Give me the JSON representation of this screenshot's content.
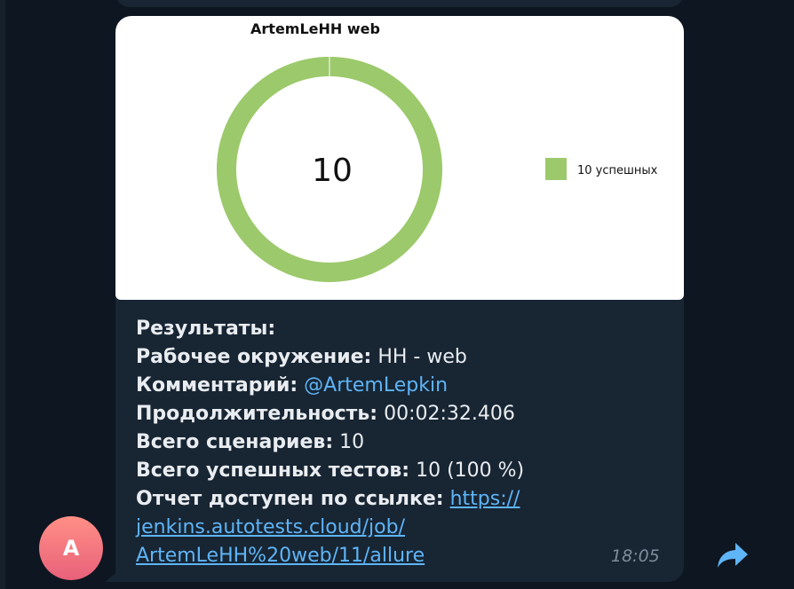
{
  "colors": {
    "background": "#0e1621",
    "bubble": "#182533",
    "link": "#5eb5f7",
    "success": "#9cc96b"
  },
  "chart_data": {
    "type": "pie",
    "title": "ArtemLeHH web",
    "center_label": "10",
    "slices": [
      {
        "label": "10 успешных",
        "value": 10,
        "color": "#9cc96b"
      }
    ],
    "legend_position": "right"
  },
  "message": {
    "results_label": "Результаты:",
    "env_label": "Рабочее окружение:",
    "env_value": " HH - web",
    "comment_label": "Комментарий:",
    "comment_value": "@ArtemLepkin",
    "duration_label": "Продолжительность:",
    "duration_value": " 00:02:32.406",
    "scenarios_label": "Всего сценариев:",
    "scenarios_value": " 10",
    "passed_label": "Всего успешных тестов:",
    "passed_value": " 10 (100 %)",
    "report_label": "Отчет доступен по ссылке:",
    "report_url_1": "https://",
    "report_url_2": "jenkins.autotests.cloud/job/",
    "report_url_3": "ArtemLeHH%20web/11/allure",
    "time": "18:05"
  },
  "sender": {
    "avatar_initial": "A"
  }
}
